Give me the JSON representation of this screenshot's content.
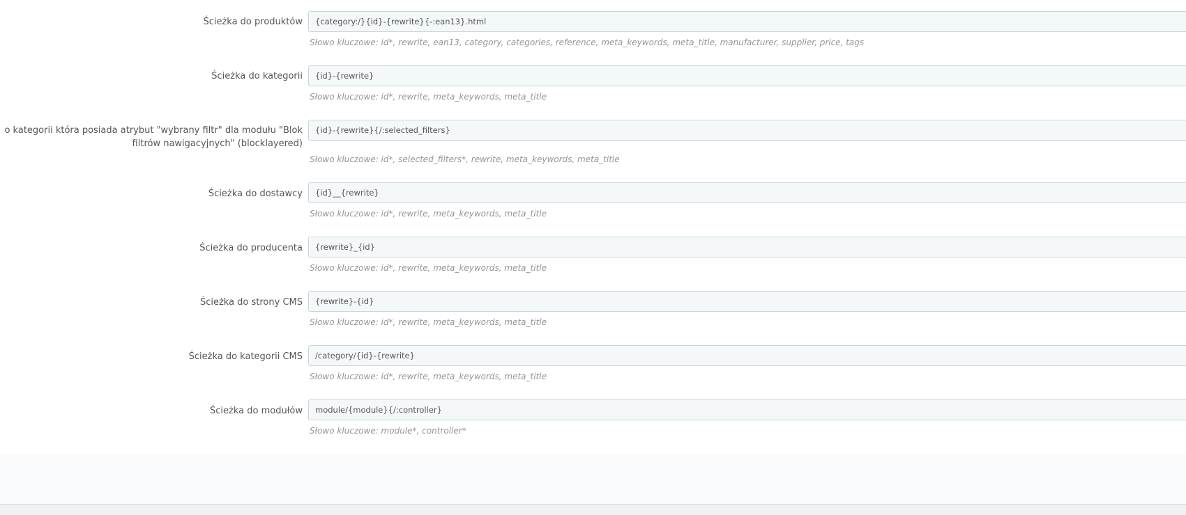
{
  "form": {
    "rows": [
      {
        "label": "Ścieżka do produktów",
        "value": "{category:/}{id}-{rewrite}{-:ean13}.html",
        "hint": "Słowo kluczowe: id*, rewrite, ean13, category, categories, reference, meta_keywords, meta_title, manufacturer, supplier, price, tags"
      },
      {
        "label": "Ścieżka do kategorii",
        "value": "{id}-{rewrite}",
        "hint": "Słowo kluczowe: id*, rewrite, meta_keywords, meta_title"
      },
      {
        "label": "o kategorii która posiada atrybut \"wybrany filtr\" dla modułu \"Blok filtrów nawigacyjnych\" (blocklayered)",
        "value": "{id}-{rewrite}{/:selected_filters}",
        "hint": "Słowo kluczowe: id*, selected_filters*, rewrite, meta_keywords, meta_title"
      },
      {
        "label": "Ścieżka do dostawcy",
        "value": "{id}__{rewrite}",
        "hint": "Słowo kluczowe: id*, rewrite, meta_keywords, meta_title"
      },
      {
        "label": "Ścieżka do producenta",
        "value": "{rewrite}_{id}",
        "hint": "Słowo kluczowe: id*, rewrite, meta_keywords, meta_title"
      },
      {
        "label": "Ścieżka do strony CMS",
        "value": "{rewrite}-{id}",
        "hint": "Słowo kluczowe: id*, rewrite, meta_keywords, meta_title"
      },
      {
        "label": "Ścieżka do kategorii CMS",
        "value": "/category/{id}-{rewrite}",
        "hint": "Słowo kluczowe: id*, rewrite, meta_keywords, meta_title"
      },
      {
        "label": "Ścieżka do modułów",
        "value": "module/{module}{/:controller}",
        "hint": "Słowo kluczowe: module*, controller*"
      }
    ]
  }
}
